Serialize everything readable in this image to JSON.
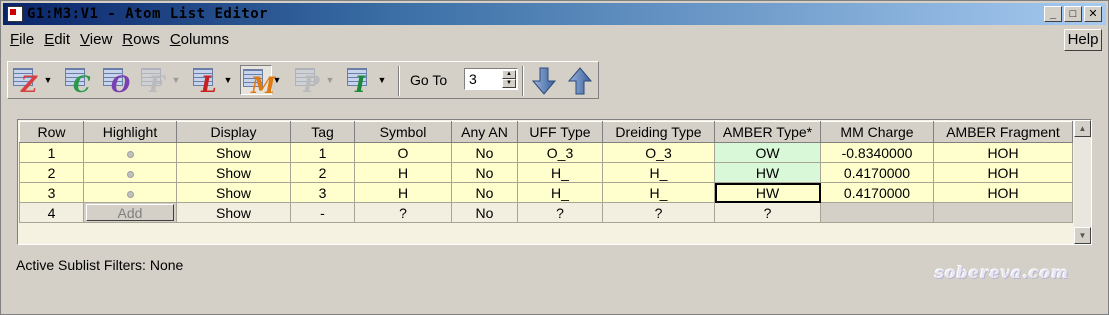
{
  "window": {
    "title": "G1:M3:V1 - Atom List Editor"
  },
  "menu": {
    "items": [
      "File",
      "Edit",
      "View",
      "Rows",
      "Columns"
    ],
    "help_label": "Help"
  },
  "toolbar": {
    "tools": [
      {
        "name": "z-matrix-tool",
        "letter": "Z",
        "color": "#d84040"
      },
      {
        "name": "cartesian-tool",
        "letter": "C",
        "color": "#2a9a4a"
      },
      {
        "name": "o-tool",
        "letter": "O",
        "color": "#7a3fb0"
      },
      {
        "name": "f-tool",
        "letter": "F",
        "color": "#c0c0c0"
      },
      {
        "name": "l-tool",
        "letter": "L",
        "color": "#c82020"
      },
      {
        "name": "m-tool",
        "letter": "M",
        "color": "#e07a10"
      },
      {
        "name": "p-tool",
        "letter": "P",
        "color": "#c0c0c0"
      },
      {
        "name": "i-tool",
        "letter": "I",
        "color": "#1a8a3a"
      }
    ],
    "goto_label": "Go To",
    "goto_value": "3"
  },
  "table": {
    "headers": [
      "Row",
      "Highlight",
      "Display",
      "Tag",
      "Symbol",
      "Any AN",
      "UFF Type",
      "Dreiding Type",
      "AMBER Type*",
      "MM Charge",
      "AMBER Fragment"
    ],
    "rows": [
      {
        "row": "1",
        "display": "Show",
        "tag": "1",
        "symbol": "O",
        "any_an": "No",
        "uff": "O_3",
        "dreiding": "O_3",
        "amber": "OW",
        "charge": "-0.8340000",
        "fragment": "HOH"
      },
      {
        "row": "2",
        "display": "Show",
        "tag": "2",
        "symbol": "H",
        "any_an": "No",
        "uff": "H_",
        "dreiding": "H_",
        "amber": "HW",
        "charge": "0.4170000",
        "fragment": "HOH"
      },
      {
        "row": "3",
        "display": "Show",
        "tag": "3",
        "symbol": "H",
        "any_an": "No",
        "uff": "H_",
        "dreiding": "H_",
        "amber": "HW",
        "charge": "0.4170000",
        "fragment": "HOH"
      }
    ],
    "new_row": {
      "row": "4",
      "add_label": "Add",
      "display": "Show",
      "tag": "-",
      "symbol": "?",
      "any_an": "No",
      "uff": "?",
      "dreiding": "?",
      "amber": "?"
    }
  },
  "status": {
    "filters_label": "Active Sublist Filters:",
    "filters_value": "None"
  },
  "watermark": "sobereva.com"
}
